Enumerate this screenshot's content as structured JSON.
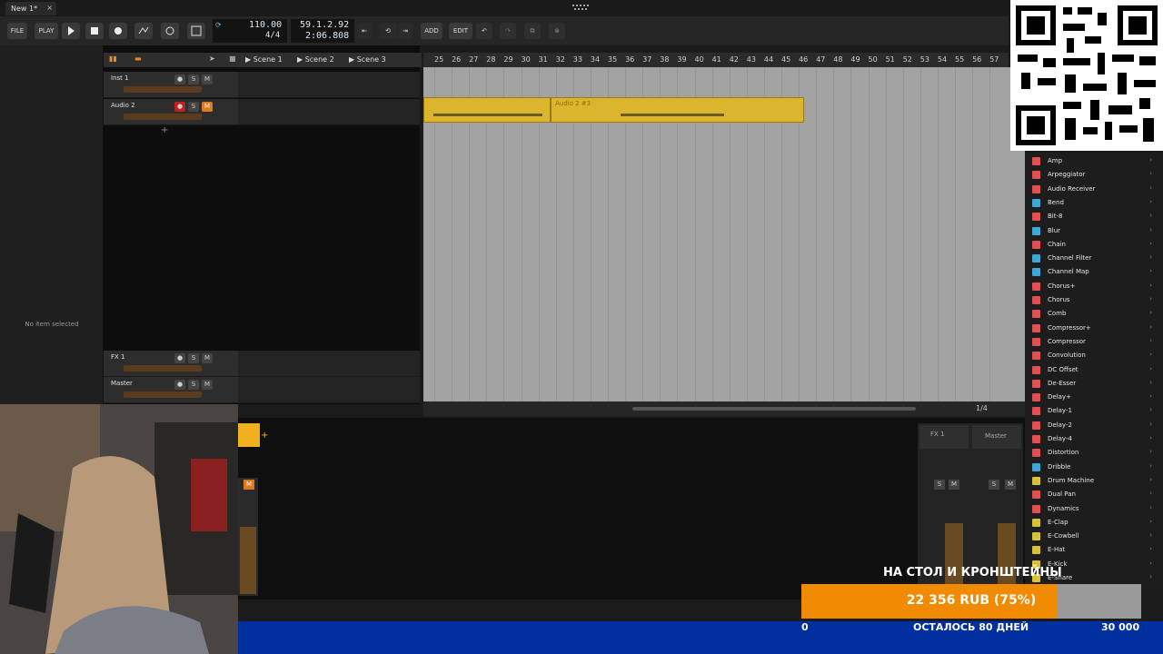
{
  "tab": {
    "label": "New 1*",
    "close": "×"
  },
  "transport": {
    "file": "FILE",
    "play": "PLAY",
    "edit": "EDIT",
    "add": "ADD",
    "tempo": "110.00",
    "signature": "4/4",
    "position": "59.1.2.92",
    "time": "2:06.808"
  },
  "inspector": {
    "empty": "No item selected"
  },
  "scenes": [
    "Scene 1",
    "Scene 2",
    "Scene 3"
  ],
  "tracks": [
    {
      "name": "Inst 1"
    },
    {
      "name": "Audio 2"
    },
    {
      "name": "FX 1"
    },
    {
      "name": "Master"
    }
  ],
  "track_buttons": {
    "s": "S",
    "m": "M"
  },
  "ruler": [
    "25",
    "26",
    "27",
    "28",
    "29",
    "30",
    "31",
    "32",
    "33",
    "34",
    "35",
    "36",
    "37",
    "38",
    "39",
    "40",
    "41",
    "42",
    "43",
    "44",
    "45",
    "46",
    "47",
    "48",
    "49",
    "50",
    "51",
    "52",
    "53",
    "54",
    "55",
    "56",
    "57"
  ],
  "clips": [
    {
      "label": "Audio 2 #3"
    }
  ],
  "grid_label": "1/4",
  "mixer": {
    "fx": "FX 1",
    "master": "Master"
  },
  "browser": [
    {
      "name": "Amp",
      "color": "#e05050"
    },
    {
      "name": "Arpeggiator",
      "color": "#e05050"
    },
    {
      "name": "Audio Receiver",
      "color": "#e05050"
    },
    {
      "name": "Bend",
      "color": "#3fa7d6"
    },
    {
      "name": "Bit-8",
      "color": "#e05050"
    },
    {
      "name": "Blur",
      "color": "#3fa7d6"
    },
    {
      "name": "Chain",
      "color": "#e05050"
    },
    {
      "name": "Channel Filter",
      "color": "#3fa7d6"
    },
    {
      "name": "Channel Map",
      "color": "#3fa7d6"
    },
    {
      "name": "Chorus+",
      "color": "#e05050"
    },
    {
      "name": "Chorus",
      "color": "#e05050"
    },
    {
      "name": "Comb",
      "color": "#e05050"
    },
    {
      "name": "Compressor+",
      "color": "#e05050"
    },
    {
      "name": "Compressor",
      "color": "#e05050"
    },
    {
      "name": "Convolution",
      "color": "#e05050"
    },
    {
      "name": "DC Offset",
      "color": "#e05050"
    },
    {
      "name": "De-Esser",
      "color": "#e05050"
    },
    {
      "name": "Delay+",
      "color": "#e05050"
    },
    {
      "name": "Delay-1",
      "color": "#e05050"
    },
    {
      "name": "Delay-2",
      "color": "#e05050"
    },
    {
      "name": "Delay-4",
      "color": "#e05050"
    },
    {
      "name": "Distortion",
      "color": "#e05050"
    },
    {
      "name": "Dribble",
      "color": "#3fa7d6"
    },
    {
      "name": "Drum Machine",
      "color": "#d8c13a"
    },
    {
      "name": "Dual Pan",
      "color": "#e05050"
    },
    {
      "name": "Dynamics",
      "color": "#e05050"
    },
    {
      "name": "E-Clap",
      "color": "#d8c13a"
    },
    {
      "name": "E-Cowbell",
      "color": "#d8c13a"
    },
    {
      "name": "E-Hat",
      "color": "#d8c13a"
    },
    {
      "name": "E-Kick",
      "color": "#d8c13a"
    },
    {
      "name": "E-Snare",
      "color": "#d8c13a"
    }
  ],
  "overlay": {
    "title": "НА СТОЛ И КРОНШТЕЙНЫ",
    "amount": "22 356 RUB (75%)",
    "progress": 0.75,
    "start": "0",
    "days": "ОСТАЛОСЬ 80 ДНЕЙ",
    "goal": "30 000"
  }
}
